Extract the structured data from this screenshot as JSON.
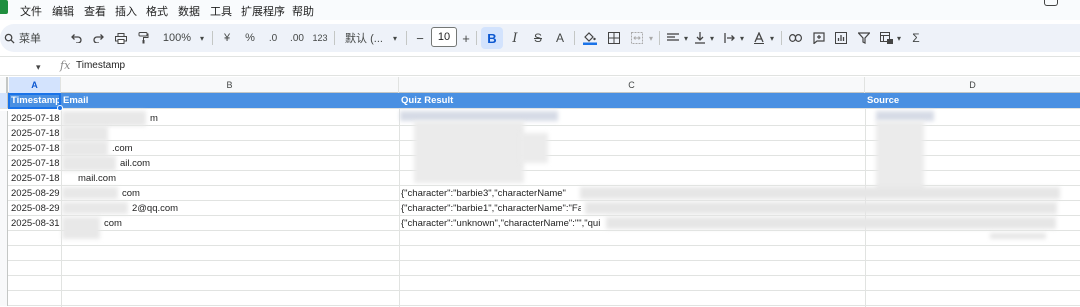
{
  "menu": {
    "items": [
      "文件",
      "编辑",
      "查看",
      "插入",
      "格式",
      "数据",
      "工具",
      "扩展程序",
      "帮助"
    ]
  },
  "toolbar": {
    "search_label": "菜单",
    "zoom": "100%",
    "currency_symbol": "¥",
    "percent_symbol": "%",
    "decrease_decimal": ".0",
    "increase_decimal": ".00",
    "number_format": "123",
    "font_name": "默认 (...",
    "font_size_minus": "−",
    "font_size": "10",
    "font_size_plus": "+",
    "bold": "B",
    "italic": "I",
    "strikethrough": "S",
    "text_color": "A",
    "function_symbol": "Σ"
  },
  "formula_bar": {
    "fx": "fx",
    "content": "Timestamp"
  },
  "columns": [
    {
      "letter": "A",
      "selected": true
    },
    {
      "letter": "B",
      "selected": false
    },
    {
      "letter": "C",
      "selected": false
    },
    {
      "letter": "D",
      "selected": false
    }
  ],
  "sheet": {
    "header": [
      "Timestamp",
      "Email",
      "Quiz Result",
      "Source"
    ],
    "rows": [
      {
        "timestamp": "2025-07-18",
        "email": "m",
        "quiz": "",
        "source": ""
      },
      {
        "timestamp": "2025-07-18",
        "email": "",
        "quiz": "",
        "source": ""
      },
      {
        "timestamp": "2025-07-18",
        "email": ".com",
        "quiz": "",
        "source": ""
      },
      {
        "timestamp": "2025-07-18",
        "email": "ail.com",
        "quiz": "",
        "source": ""
      },
      {
        "timestamp": "2025-07-18",
        "email": "mail.com",
        "quiz": "",
        "source": ""
      },
      {
        "timestamp": "2025-08-29",
        "email": "com",
        "quiz": "{\"character\":\"barbie3\",\"characterName\"",
        "source": ""
      },
      {
        "timestamp": "2025-08-29",
        "email": "2@qq.com",
        "quiz": "{\"character\":\"barbie1\",\"characterName\":\"Fa",
        "source": ""
      },
      {
        "timestamp": "2025-08-31",
        "email": "com",
        "quiz": "{\"character\":\"unknown\",\"characterName\":\"\",\"qui",
        "source": ""
      }
    ]
  },
  "colors": {
    "header_fill": "#4a90e2",
    "selection": "#1a73e8",
    "toolbar_bg": "#eef2f9"
  }
}
